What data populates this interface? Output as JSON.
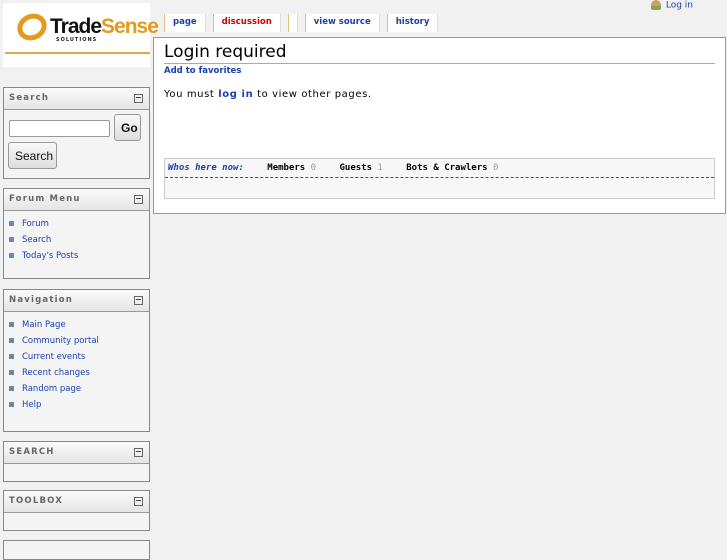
{
  "logo": {
    "text_a": "Trade",
    "text_b": "Sense",
    "sub": "SOLUTIONS"
  },
  "personal": {
    "login": "Log in"
  },
  "tabs": [
    {
      "label": "page"
    },
    {
      "label": "discussion"
    },
    {
      "label": "view source"
    },
    {
      "label": "history"
    }
  ],
  "content": {
    "title": "Login required",
    "favorites": "Add to favorites",
    "msg_pre": "You must ",
    "msg_link": "log in",
    "msg_post": " to view other pages.",
    "who": {
      "label": "Whos here now:",
      "members_label": "Members",
      "members": "0",
      "guests_label": "Guests",
      "guests": "1",
      "bots_label": "Bots & Crawlers",
      "bots": "0"
    }
  },
  "sidebar": {
    "search": {
      "title": "Search",
      "go": "Go",
      "search": "Search",
      "input_value": ""
    },
    "forum": {
      "title": "Forum Menu",
      "items": [
        "Forum",
        "Search",
        "Today's Posts"
      ]
    },
    "nav": {
      "title": "Navigation",
      "items": [
        "Main Page",
        "Community portal",
        "Current events",
        "Recent changes",
        "Random page",
        "Help"
      ]
    },
    "search2": {
      "title": "SEARCH"
    },
    "toolbox": {
      "title": "TOOLBOX"
    },
    "collapse": "−"
  },
  "colors": {
    "link": "#1a40b0",
    "accent": "#e39a1d",
    "discussion": "#cc0000"
  }
}
